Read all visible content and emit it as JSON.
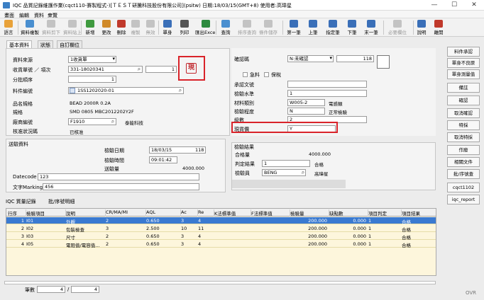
{
  "window": {
    "title": "IQC 品質記錄維護作業(cqct110-賽製程式-)[ＴＥＳＴ研騰科技股份有限公司](psitw)  日期:18/03/15(GMT+8)  使用者:高瑋星",
    "controls": {
      "minimize": "—",
      "maximize": "☐",
      "close": "✕"
    }
  },
  "menu": [
    "畫面",
    "編輯",
    "資料",
    "衆覽"
  ],
  "toolbar": [
    {
      "label": "語言",
      "icon": "language-icon",
      "enabled": true,
      "color": "#e8a23a"
    },
    {
      "label": "資料複製",
      "icon": "copy-record-icon",
      "enabled": true,
      "color": "#4a8fd0"
    },
    {
      "label": "資料剪下",
      "icon": "cut-record-icon",
      "enabled": false,
      "color": "#8a8a8a"
    },
    {
      "label": "資料貼上",
      "icon": "paste-record-icon",
      "enabled": false,
      "color": "#8a8a8a"
    },
    {
      "label": "新增",
      "icon": "new-icon",
      "enabled": true,
      "color": "#3f9a3f"
    },
    {
      "label": "更改",
      "icon": "edit-icon",
      "enabled": true,
      "color": "#d08a2a"
    },
    {
      "label": "刪除",
      "icon": "delete-icon",
      "enabled": true,
      "color": "#c0392b"
    },
    {
      "label": "複製",
      "icon": "duplicate-icon",
      "enabled": false,
      "color": "#8a8a8a"
    },
    {
      "label": "無效",
      "icon": "invalid-icon",
      "enabled": false,
      "color": "#8a8a8a"
    },
    {
      "label": "單身",
      "icon": "detail-icon",
      "enabled": true,
      "color": "#3a6fb8"
    },
    {
      "label": "列印",
      "icon": "print-icon",
      "enabled": true,
      "color": "#555"
    },
    {
      "label": "匯出Excel",
      "icon": "excel-icon",
      "enabled": true,
      "color": "#2e8b3f"
    },
    {
      "label": "查詢",
      "icon": "query-icon",
      "enabled": true,
      "color": "#4a8fd0"
    },
    {
      "label": "排序查詢",
      "icon": "sort-query-icon",
      "enabled": false,
      "color": "#8a8a8a"
    },
    {
      "label": "條件儲存",
      "icon": "save-condition-icon",
      "enabled": false,
      "color": "#8a8a8a"
    },
    {
      "label": "第一筆",
      "icon": "first-icon",
      "enabled": true,
      "color": "#3a6fb8"
    },
    {
      "label": "上筆",
      "icon": "prev-icon",
      "enabled": true,
      "color": "#3a6fb8"
    },
    {
      "label": "指定筆",
      "icon": "goto-icon",
      "enabled": true,
      "color": "#3a6fb8"
    },
    {
      "label": "下筆",
      "icon": "next-icon",
      "enabled": true,
      "color": "#3a6fb8"
    },
    {
      "label": "末一筆",
      "icon": "last-icon",
      "enabled": true,
      "color": "#3a6fb8"
    },
    {
      "label": "必要欄位",
      "icon": "required-icon",
      "enabled": false,
      "color": "#8a8a8a"
    },
    {
      "label": "說明",
      "icon": "help-icon",
      "enabled": true,
      "color": "#3a6fb8"
    },
    {
      "label": "離開",
      "icon": "exit-icon",
      "enabled": true,
      "color": "#c0392b"
    }
  ],
  "tabs": [
    "基本資料",
    "狀態",
    "自訂欄位"
  ],
  "basic": {
    "source_label": "資料來源",
    "source_value": "1收貨單",
    "receipt_label": "收貨單號 ／ 項次",
    "receipt_no": "331-18020341",
    "receipt_item": "1",
    "batch_label": "分批順序",
    "batch_value": "1",
    "part_label": "料件編號",
    "part_value": "1SS1202020-01",
    "name_label": "品名規格",
    "name_value": "BEAD 2000R 0.2A",
    "spec_label": "規格",
    "spec_value": "SMD 0805 MBC2012202Y2F",
    "vendor_label": "廠商編號",
    "vendor_code": "F1910",
    "vendor_name": "泰能科技",
    "approval_label": "核准狀況碼",
    "approval_value": "已核准",
    "stamp_char": "現"
  },
  "right": {
    "confirm_label": "確認碼",
    "confirm_value": "N:未確認",
    "confirm_extra": "118",
    "urgent_label": "急料",
    "bonded_label": "保稅",
    "doc_label": "承認文號",
    "doc_value": "",
    "level_label": "檢驗水準",
    "level_value": "1",
    "category_label": "材料類別",
    "category_code": "W005-2",
    "category_name": "電感類",
    "degree_label": "檢驗程度",
    "degree_code": "N",
    "degree_name": "正常檢驗",
    "grade_label": "級數",
    "grade_value": "2",
    "cash_label": "現貨價",
    "cash_value": "Y"
  },
  "inspect": {
    "group_label": "送驗資料",
    "date_label": "檢驗日期",
    "date_value": "18/03/15",
    "date_extra": "118",
    "time_label": "檢驗時間",
    "time_value": "09:01:42",
    "qty_label": "送驗量",
    "qty_value": "4000.000",
    "datecode_label": "Datecode",
    "datecode_value": "123",
    "marking_label": "文字Marking",
    "marking_value": "456"
  },
  "result": {
    "group_label": "檢驗結果",
    "pass_label": "合格量",
    "pass_value": "4000.000",
    "judge_label": "判定結果",
    "judge_code": "1",
    "judge_name": "合格",
    "inspector_label": "檢驗員",
    "inspector_code": "BENG",
    "inspector_name": "高瑋星"
  },
  "side_buttons": [
    "料件承認",
    "單身不良原",
    "單身測量值",
    "備註",
    "確認",
    "取消確認",
    "特採",
    "取消特採",
    "作廢",
    "相關文件",
    "批/序號查",
    "cqct1102",
    "iqc_report"
  ],
  "grid": {
    "tabs": [
      "IQC 質量記錄",
      "批/序號明細"
    ],
    "headers": [
      "行序",
      "檢驗項目",
      "說明",
      "CR/MA/MI",
      "AQL",
      "Ac",
      "Re",
      "K法標準值",
      "F法標準值",
      "檢驗量",
      "缺點數",
      "項目判定",
      "項目結果"
    ],
    "rows": [
      [
        "1",
        "I01",
        "外觀",
        "2",
        "0.650",
        "3",
        "4",
        "",
        "",
        "200.000",
        "0.000",
        "1",
        "合格"
      ],
      [
        "2",
        "I02",
        "包裝檢查",
        "3",
        "2.500",
        "10",
        "11",
        "",
        "",
        "200.000",
        "0.000",
        "1",
        "合格"
      ],
      [
        "3",
        "I03",
        "尺寸",
        "2",
        "0.650",
        "3",
        "4",
        "",
        "",
        "200.000",
        "0.000",
        "1",
        "合格"
      ],
      [
        "4",
        "I05",
        "電阻值/電容值...",
        "2",
        "0.650",
        "3",
        "4",
        "",
        "",
        "200.000",
        "0.000",
        "1",
        "合格"
      ]
    ]
  },
  "status": {
    "count_label": "筆數",
    "current": "4",
    "total": "4",
    "mode": "OVR"
  },
  "colors": {
    "selection": "#3a7ad1",
    "highlight_box": "#d9232a",
    "grid_bg": "#fdf6dc"
  }
}
